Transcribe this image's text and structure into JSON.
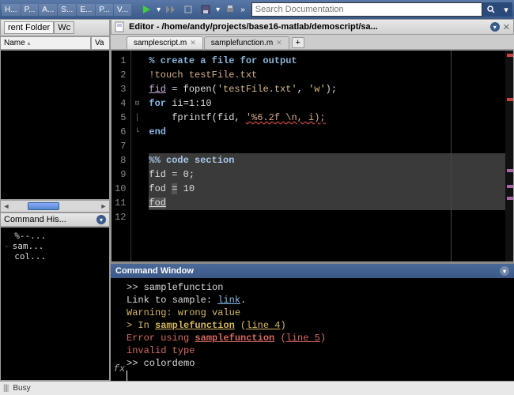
{
  "toolbar": {
    "tabs": [
      "H...",
      "P...",
      "A...",
      "S...",
      "E...",
      "P...",
      "V..."
    ],
    "search_placeholder": "Search Documentation"
  },
  "folder": {
    "title": "rent Folder",
    "wc": "Wc",
    "cols": {
      "name": "Name",
      "val": "Va"
    }
  },
  "history": {
    "title": "Command His...",
    "lines": [
      "%--...",
      "sam...",
      "col..."
    ]
  },
  "editor": {
    "title": "Editor - /home/andy/projects/base16-matlab/demoscript/sa...",
    "tabs": [
      {
        "label": "samplescript.m",
        "active": true
      },
      {
        "label": "samplefunction.m",
        "active": false
      }
    ],
    "code": [
      {
        "n": 1,
        "seg": [
          {
            "t": "% create a file for output",
            "c": "c-comment"
          }
        ]
      },
      {
        "n": 2,
        "seg": [
          {
            "t": "!touch testFile.txt",
            "c": "c-cmd"
          }
        ]
      },
      {
        "n": 3,
        "seg": [
          {
            "t": "fid",
            "c": "c-var uline"
          },
          {
            "t": " = fopen(",
            "c": ""
          },
          {
            "t": "'testFile.txt'",
            "c": "c-str"
          },
          {
            "t": ", ",
            "c": ""
          },
          {
            "t": "'w'",
            "c": "c-str"
          },
          {
            "t": ");",
            "c": ""
          }
        ]
      },
      {
        "n": 4,
        "seg": [
          {
            "t": "for",
            "c": "c-kw"
          },
          {
            "t": " ii=1:10",
            "c": ""
          }
        ],
        "fold": "⊟"
      },
      {
        "n": 5,
        "seg": [
          {
            "t": "    fprintf(fid, ",
            "c": ""
          },
          {
            "t": "'%6.2f \\n, i);",
            "c": "c-err"
          }
        ],
        "fold": "│"
      },
      {
        "n": 6,
        "seg": [
          {
            "t": "end",
            "c": "c-kw"
          }
        ],
        "fold": "└"
      },
      {
        "n": 7,
        "seg": [
          {
            "t": "",
            "c": ""
          }
        ]
      },
      {
        "n": 8,
        "seg": [
          {
            "t": "%% code section",
            "c": "c-section"
          }
        ],
        "hl": true
      },
      {
        "n": 9,
        "seg": [
          {
            "t": "fid = 0;",
            "c": ""
          }
        ],
        "hl": true
      },
      {
        "n": 10,
        "seg": [
          {
            "t": "fod ",
            "c": ""
          },
          {
            "t": "=",
            "c": "c-sel"
          },
          {
            "t": " 10",
            "c": ""
          }
        ],
        "hl": true
      },
      {
        "n": 11,
        "seg": [
          {
            "t": "fod",
            "c": "c-sel uline"
          }
        ],
        "hl": true
      },
      {
        "n": 12,
        "seg": [
          {
            "t": "",
            "c": ""
          }
        ]
      }
    ]
  },
  "cmdwin": {
    "title": "Command Window",
    "lines": [
      [
        {
          "t": ">> samplefunction",
          "c": ""
        }
      ],
      [
        {
          "t": "Link to sample: ",
          "c": ""
        },
        {
          "t": "link",
          "c": "l-link"
        },
        {
          "t": ".",
          "c": ""
        }
      ],
      [
        {
          "t": "Warning: wrong value",
          "c": "l-warn"
        }
      ],
      [
        {
          "t": "> In ",
          "c": "l-warn"
        },
        {
          "t": "samplefunction",
          "c": "l-warn l-fn"
        },
        {
          "t": " (",
          "c": "l-warn"
        },
        {
          "t": "line 4",
          "c": "l-warn uline"
        },
        {
          "t": ")",
          "c": "l-warn"
        }
      ],
      [
        {
          "t": "Error using ",
          "c": "l-err"
        },
        {
          "t": "samplefunction",
          "c": "l-err l-fn"
        },
        {
          "t": " (",
          "c": "l-err"
        },
        {
          "t": "line 5",
          "c": "l-err uline"
        },
        {
          "t": ")",
          "c": "l-err"
        }
      ],
      [
        {
          "t": "invalid type",
          "c": "l-err"
        }
      ],
      [
        {
          "t": ">> colordemo",
          "c": ""
        }
      ]
    ],
    "fx": "fx"
  },
  "status": {
    "text": "Busy"
  }
}
